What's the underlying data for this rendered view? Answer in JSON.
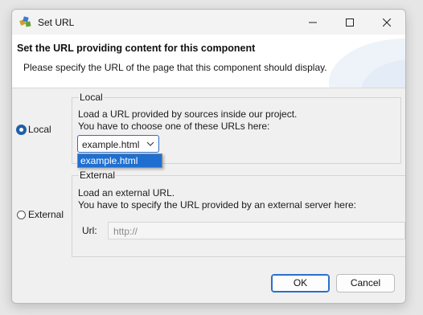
{
  "window": {
    "title": "Set URL"
  },
  "header": {
    "title": "Set the URL providing content for this component",
    "description": "Please specify the URL of the page that this component should display."
  },
  "local": {
    "radio_label": "Local",
    "selected": true,
    "group_label": "Local",
    "line1": "Load a URL provided by sources inside our project.",
    "line2": "You have to choose one of these URLs here:",
    "combo_value": "example.html",
    "dropdown_options": [
      "example.html"
    ]
  },
  "external": {
    "radio_label": "External",
    "selected": false,
    "group_label": "External",
    "line1": "Load an external URL.",
    "line2": "You have to specify the URL provided by an external server here:",
    "url_label": "Url:",
    "url_placeholder": "http://"
  },
  "buttons": {
    "ok": "OK",
    "cancel": "Cancel"
  },
  "colors": {
    "accent": "#1f6fd1",
    "dialog_bg": "#f0f0f0",
    "header_bg": "#ffffff"
  }
}
